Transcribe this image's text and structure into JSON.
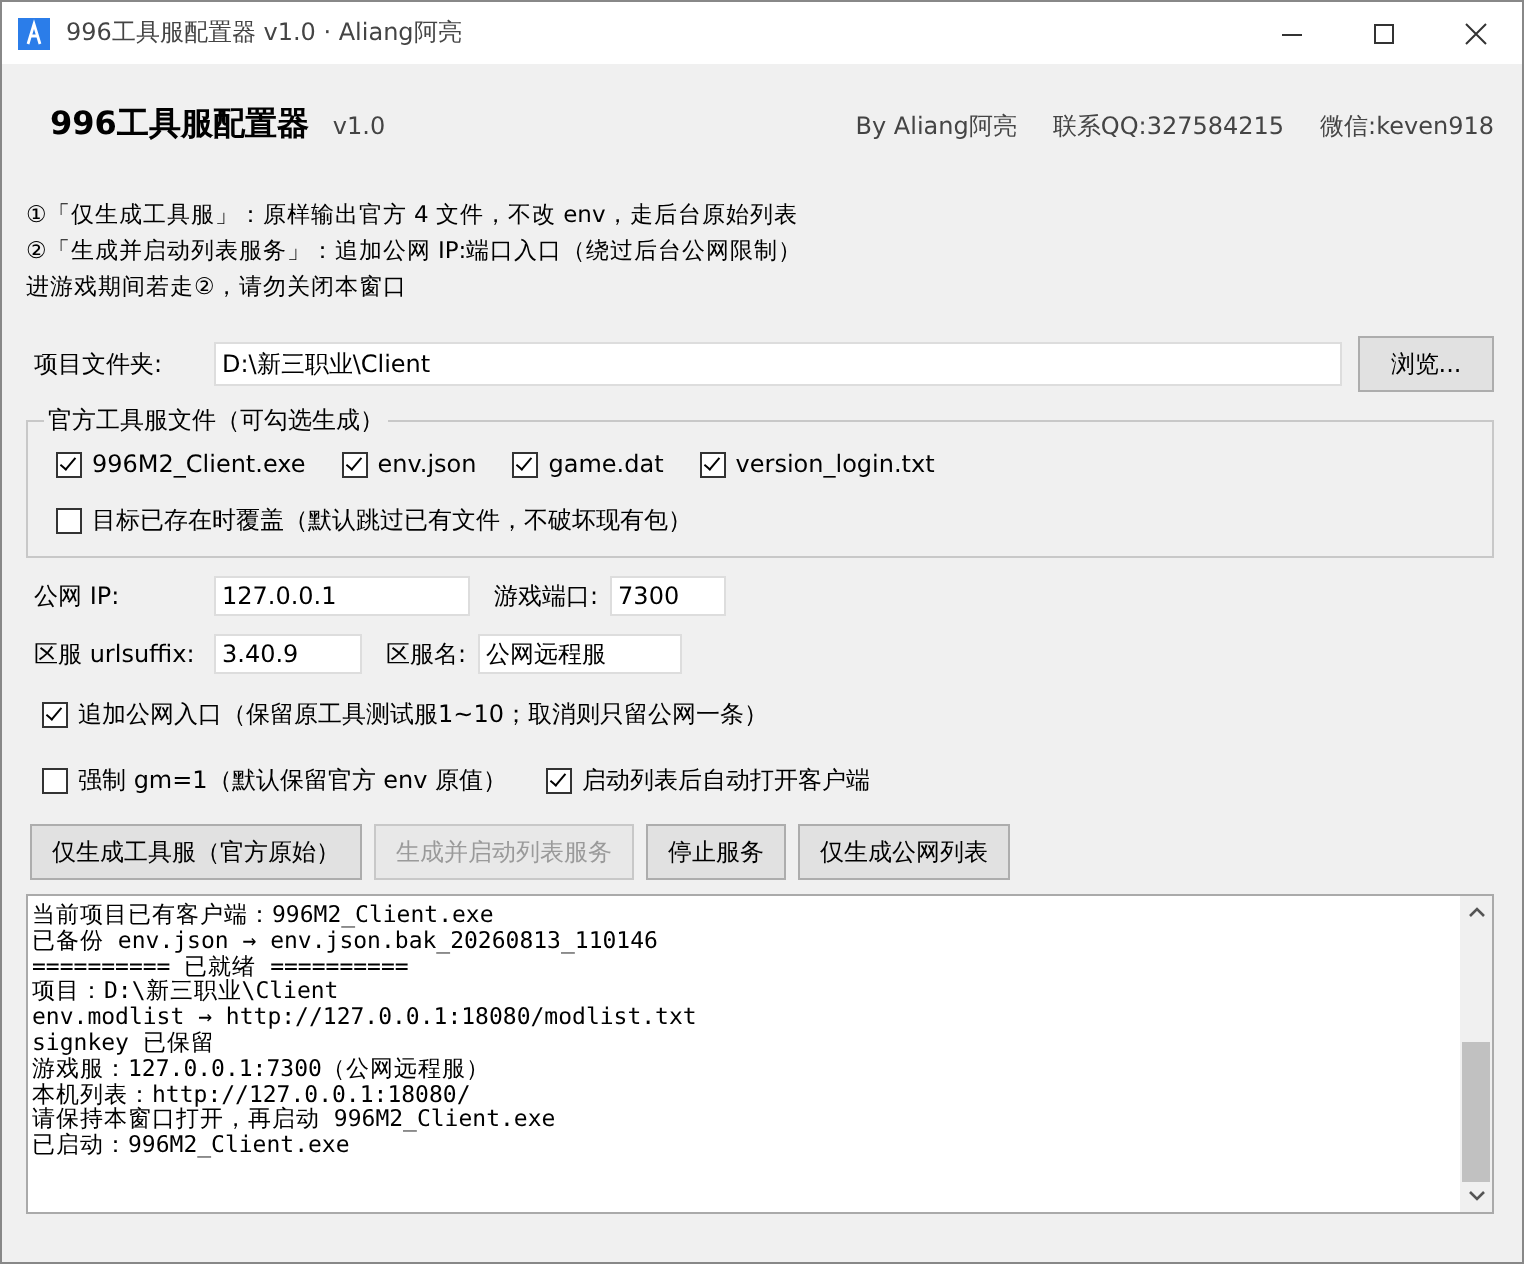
{
  "window": {
    "title": "996工具服配置器 v1.0 · Aliang阿亮"
  },
  "header": {
    "title": "996工具服配置器",
    "version": "v1.0",
    "author": "By Aliang阿亮",
    "qq": "联系QQ:327584215",
    "wechat": "微信:keven918"
  },
  "notes": [
    "①「仅生成工具服」：原样输出官方 4 文件，不改 env，走后台原始列表",
    "②「生成并启动列表服务」：追加公网 IP:端口入口（绕过后台公网限制）",
    "进游戏期间若走②，请勿关闭本窗口"
  ],
  "folder": {
    "label": "项目文件夹:",
    "value": "D:\\新三职业\\Client",
    "button": "浏览..."
  },
  "files_group": {
    "title": "官方工具服文件（可勾选生成）",
    "files": [
      {
        "label": "996M2_Client.exe",
        "checked": true
      },
      {
        "label": "env.json",
        "checked": true
      },
      {
        "label": "game.dat",
        "checked": true
      },
      {
        "label": "version_login.txt",
        "checked": true
      }
    ],
    "overwrite": {
      "label": "目标已存在时覆盖（默认跳过已有文件，不破坏现有包）",
      "checked": false
    }
  },
  "ip": {
    "label": "公网 IP:",
    "value": "127.0.0.1"
  },
  "port": {
    "label": "游戏端口:",
    "value": "7300"
  },
  "urlsuffix": {
    "label": "区服 urlsuffix:",
    "value": "3.40.9"
  },
  "server_name": {
    "label": "区服名:",
    "value": "公网远程服"
  },
  "options": [
    {
      "label": "追加公网入口（保留原工具测试服1~10；取消则只留公网一条）",
      "checked": true
    },
    {
      "label": "强制 gm=1（默认保留官方 env 原值）",
      "checked": false
    },
    {
      "label": "启动列表后自动打开客户端",
      "checked": true
    }
  ],
  "buttons": [
    {
      "label": "仅生成工具服（官方原始）",
      "disabled": false
    },
    {
      "label": "生成并启动列表服务",
      "disabled": true
    },
    {
      "label": "停止服务",
      "disabled": false
    },
    {
      "label": "仅生成公网列表",
      "disabled": false
    }
  ],
  "log": [
    "当前项目已有客户端：996M2_Client.exe",
    "已备份 env.json → env.json.bak_20260813_110146",
    "========== 已就绪 ==========",
    "项目：D:\\新三职业\\Client",
    "env.modlist → http://127.0.0.1:18080/modlist.txt",
    "signkey 已保留",
    "游戏服：127.0.0.1:7300（公网远程服）",
    "本机列表：http://127.0.0.1:18080/",
    "请保持本窗口打开，再启动 996M2_Client.exe",
    "已启动：996M2_Client.exe"
  ]
}
